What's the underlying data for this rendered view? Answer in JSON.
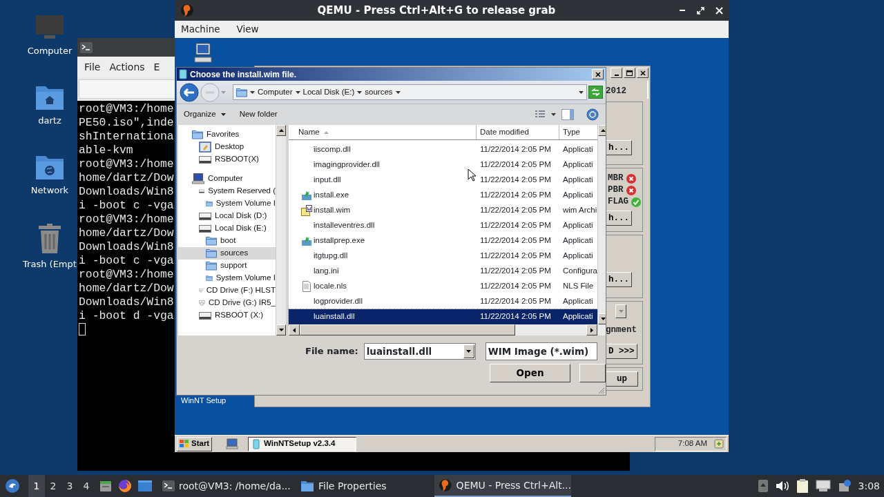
{
  "desktop_icons": [
    {
      "label": "Computer",
      "kind": "computer"
    },
    {
      "label": "dartz",
      "kind": "home"
    },
    {
      "label": "Network",
      "kind": "network"
    },
    {
      "label": "Trash (Empt",
      "kind": "trash"
    }
  ],
  "terminal": {
    "menu": [
      "File",
      "Actions",
      "E"
    ],
    "lines": [
      "root@VM3:/home",
      "PE50.iso\",inde",
      "shInternationa",
      "able-kvm",
      "root@VM3:/home",
      "home/dartz/Dow",
      "Downloads/Win8",
      "i -boot c -vga",
      "root@VM3:/home",
      "home/dartz/Dow",
      "Downloads/Win8",
      "i -boot c -vga",
      "root@VM3:/home",
      "home/dartz/Dow",
      "Downloads/Win8",
      "i -boot d -vga"
    ]
  },
  "qemu": {
    "title": "QEMU - Press Ctrl+Alt+G to release grab",
    "menu": [
      "Machine",
      "View"
    ],
    "guest": {
      "icon_label": "WinNT Setup",
      "winntsetup": {
        "version_fragment": "2012",
        "browse_buttons": [
          "h...",
          "h...",
          "h..."
        ],
        "boot_checks": [
          {
            "label": "MBR",
            "ok": false
          },
          {
            "label": "PBR",
            "ok": false
          },
          {
            "label": "FLAG",
            "ok": true
          }
        ],
        "alignment_label": "gnment",
        "next_button": "D >>>",
        "setup_button": "up"
      },
      "dialog": {
        "title": "Choose the install.wim file.",
        "breadcrumb": [
          "Computer",
          "Local Disk (E:)",
          "sources"
        ],
        "commands": [
          "Organize",
          "New folder"
        ],
        "tree": [
          {
            "label": "Favorites",
            "kind": "favorites",
            "selected": false,
            "children": [
              {
                "label": "Desktop",
                "kind": "desktop",
                "selected": false
              },
              {
                "label": "RSBOOT(X)",
                "kind": "drive",
                "selected": false
              }
            ]
          },
          {
            "label": "Computer",
            "kind": "computer",
            "selected": false,
            "children": [
              {
                "label": "System Reserved (",
                "kind": "drive",
                "selected": false,
                "children": [
                  {
                    "label": "System Volume I",
                    "kind": "folder",
                    "selected": false
                  }
                ]
              },
              {
                "label": "Local Disk (D:)",
                "kind": "drive",
                "selected": false
              },
              {
                "label": "Local Disk (E:)",
                "kind": "drive",
                "selected": false,
                "children": [
                  {
                    "label": "boot",
                    "kind": "folder",
                    "selected": false
                  },
                  {
                    "label": "sources",
                    "kind": "folder",
                    "selected": true
                  },
                  {
                    "label": "support",
                    "kind": "folder",
                    "selected": false
                  },
                  {
                    "label": "System Volume I",
                    "kind": "folder",
                    "selected": false
                  }
                ]
              },
              {
                "label": "CD Drive (F:) HLST",
                "kind": "cd",
                "selected": false
              },
              {
                "label": "CD Drive (G:) IR5_",
                "kind": "cd",
                "selected": false
              },
              {
                "label": "RSBOOT (X:)",
                "kind": "drive",
                "selected": false
              }
            ]
          }
        ],
        "columns": [
          "Name",
          "Date modified",
          "Type"
        ],
        "files": [
          {
            "name": "iiscomp.dll",
            "date": "11/22/2014 2:05 PM",
            "type": "Applicati",
            "kind": "plain",
            "selected": false
          },
          {
            "name": "imagingprovider.dll",
            "date": "11/22/2014 2:05 PM",
            "type": "Applicati",
            "kind": "plain",
            "selected": false
          },
          {
            "name": "input.dll",
            "date": "11/22/2014 2:05 PM",
            "type": "Applicati",
            "kind": "plain",
            "selected": false
          },
          {
            "name": "install.exe",
            "date": "11/22/2014 2:05 PM",
            "type": "Applicati",
            "kind": "exe",
            "selected": false
          },
          {
            "name": "install.wim",
            "date": "11/22/2014 2:05 PM",
            "type": "wim Archi",
            "kind": "wim",
            "selected": false
          },
          {
            "name": "installeventres.dll",
            "date": "11/22/2014 2:05 PM",
            "type": "Applicati",
            "kind": "plain",
            "selected": false
          },
          {
            "name": "installprep.exe",
            "date": "11/22/2014 2:05 PM",
            "type": "Applicati",
            "kind": "exe",
            "selected": false
          },
          {
            "name": "itgtupg.dll",
            "date": "11/22/2014 2:05 PM",
            "type": "Applicati",
            "kind": "plain",
            "selected": false
          },
          {
            "name": "lang.ini",
            "date": "11/22/2014 2:05 PM",
            "type": "Configura",
            "kind": "plain",
            "selected": false
          },
          {
            "name": "locale.nls",
            "date": "11/22/2014 2:05 PM",
            "type": "NLS File",
            "kind": "doc",
            "selected": false
          },
          {
            "name": "logprovider.dll",
            "date": "11/22/2014 2:05 PM",
            "type": "Applicati",
            "kind": "plain",
            "selected": false
          },
          {
            "name": "luainstall.dll",
            "date": "11/22/2014 2:05 PM",
            "type": "Applicati",
            "kind": "plain",
            "selected": true
          }
        ],
        "file_name_label": "File name:",
        "file_name": "luainstall.dll",
        "filter": "WIM Image (*.wim)",
        "open_button": "Open"
      },
      "taskbar": {
        "start": "Start",
        "tasks": [
          {
            "label": "WinNTSetup v2.3.4",
            "selected": true
          }
        ],
        "clock": "7:08 AM"
      }
    }
  },
  "taskbar": {
    "workspaces": [
      {
        "label": "1",
        "selected": true
      },
      {
        "label": "2",
        "selected": false
      },
      {
        "label": "3",
        "selected": false
      },
      {
        "label": "4",
        "selected": false
      }
    ],
    "tasks": [
      {
        "label": "root@VM3: /home/da...",
        "kind": "terminal",
        "selected": false
      },
      {
        "label": "File Properties",
        "kind": "folder",
        "selected": false
      },
      {
        "label": "QEMU - Press Ctrl+Alt...",
        "kind": "qemu",
        "selected": true
      }
    ],
    "clock": "3:08"
  }
}
